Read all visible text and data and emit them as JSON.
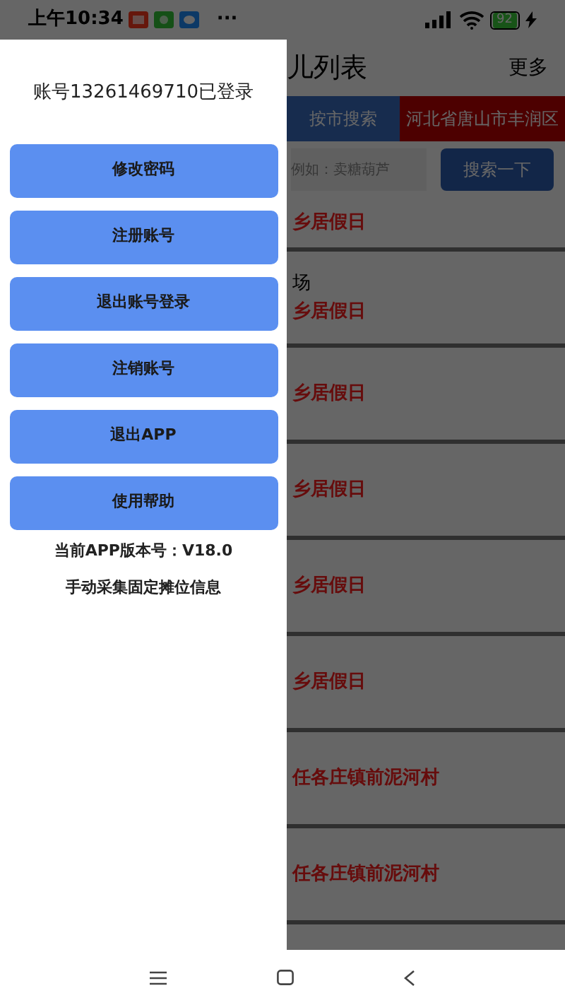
{
  "status_bar": {
    "time": "上午10:34",
    "more": "···",
    "battery": "92"
  },
  "app": {
    "title": "儿列表",
    "more": "更多",
    "tabs": [
      {
        "label": "按市搜索",
        "kind": "action"
      },
      {
        "label": "河北省唐山市丰润区",
        "kind": "value"
      }
    ],
    "search": {
      "placeholder": "例如：卖糖葫芦",
      "button": "搜索一下"
    },
    "rows": [
      {
        "title": "乡居假日"
      },
      {
        "note": "场",
        "title": "乡居假日"
      },
      {
        "title": "乡居假日"
      },
      {
        "title": "乡居假日"
      },
      {
        "title": "乡居假日"
      },
      {
        "title": "乡居假日"
      },
      {
        "title": "任各庄镇前泥河村"
      },
      {
        "title": "任各庄镇前泥河村"
      }
    ]
  },
  "drawer": {
    "account": "账号13261469710已登录",
    "buttons": [
      "修改密码",
      "注册账号",
      "退出账号登录",
      "注销账号",
      "退出APP",
      "使用帮助"
    ],
    "version": "当前APP版本号：V18.0",
    "footer": "手动采集固定摊位信息"
  }
}
